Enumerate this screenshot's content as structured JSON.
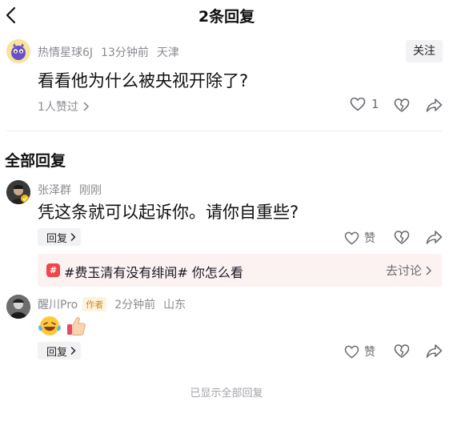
{
  "header": {
    "title": "2条回复"
  },
  "root_comment": {
    "user": "热情星球6J",
    "time": "13分钟前",
    "location": "天津",
    "follow_label": "关注",
    "text": "看看他为什么被央视开除了?",
    "liked_by": "1人赞过",
    "like_count": "1"
  },
  "section": {
    "title": "全部回复"
  },
  "replies": [
    {
      "user": "张泽群",
      "time": "刚刚",
      "text": "凭这条就可以起诉你。请你自重些?",
      "reply_label": "回复",
      "like_label": "赞"
    },
    {
      "user": "醒川Pro",
      "badge": "作者",
      "time": "2分钟前",
      "location": "山东",
      "reply_label": "回复",
      "like_label": "赞"
    }
  ],
  "topic": {
    "icon_text": "#",
    "text": "#费玉清有没有绯闻# 你怎么看",
    "action": "去讨论"
  },
  "footer": {
    "note": "已显示全部回复"
  },
  "icons": [
    "back-icon",
    "heart-icon",
    "dislike-icon",
    "share-icon",
    "chevron-right-icon",
    "crying-laughing-emoji",
    "thumbs-up-emoji"
  ],
  "colors": {
    "topic_bg": "#fdf2f2",
    "topic_icon": "#f1454a",
    "author_badge": "#c98a1d",
    "muted": "#8a8b91"
  }
}
